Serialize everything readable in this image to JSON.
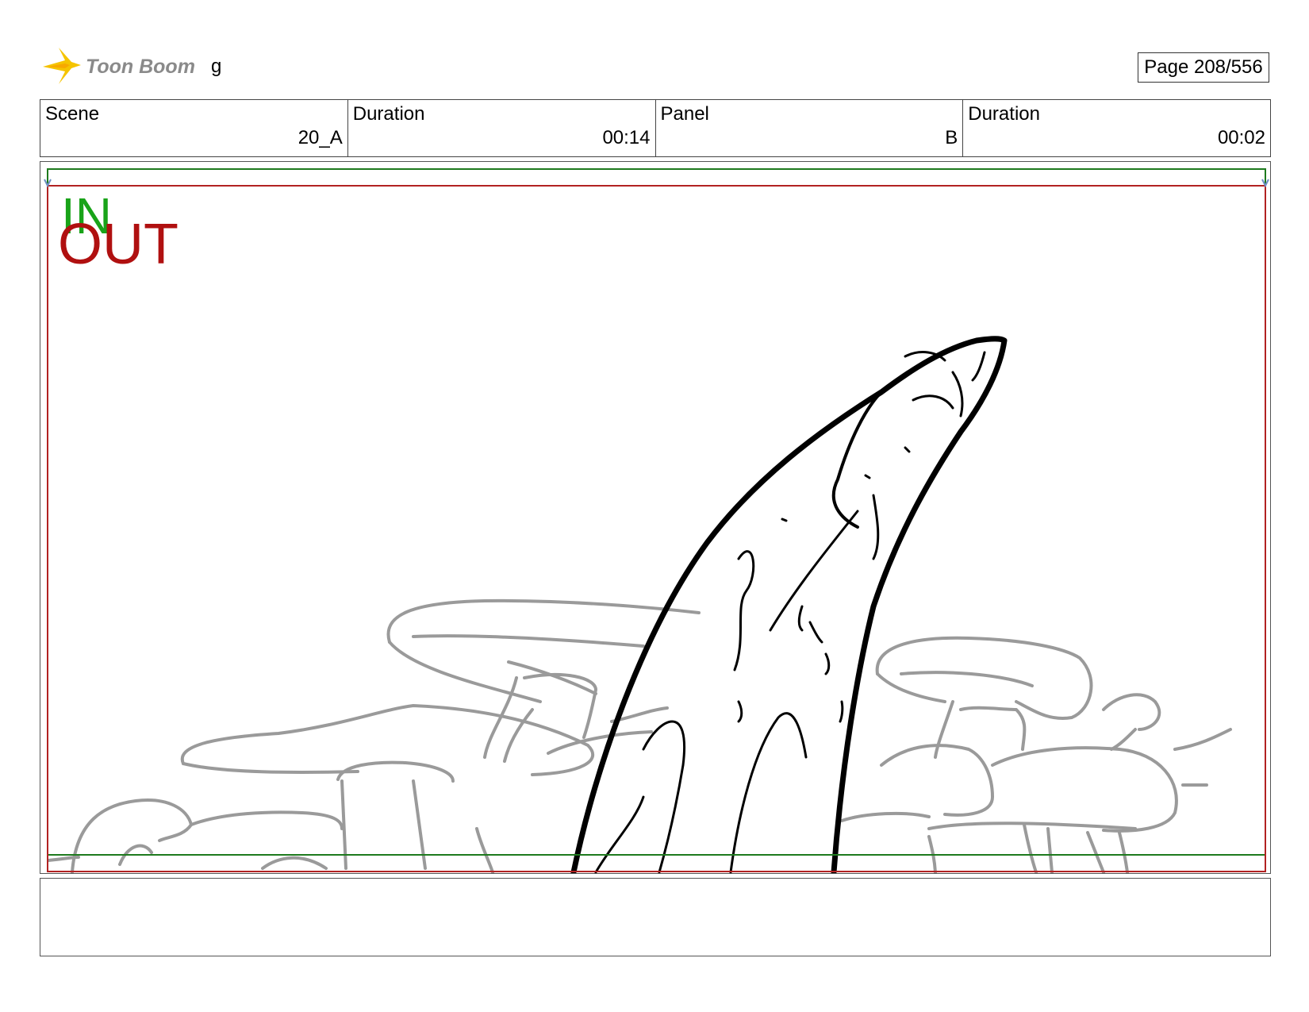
{
  "header": {
    "logo_text": "Toon Boom",
    "project_name": "g",
    "page": "Page 208/556"
  },
  "info": {
    "scene_label": "Scene",
    "scene_value": "20_A",
    "scene_duration_label": "Duration",
    "scene_duration_value": "00:14",
    "panel_label": "Panel",
    "panel_value": "B",
    "panel_duration_label": "Duration",
    "panel_duration_value": "00:02"
  },
  "panel": {
    "in_label": "IN",
    "out_label": "OUT",
    "colors": {
      "in_frame": "#1e7a1e",
      "out_frame": "#b22222",
      "in_text": "#19a319",
      "out_text": "#b01010",
      "sketch_main": "#000000",
      "sketch_background": "#9a9a9a"
    }
  },
  "caption": {
    "text": ""
  }
}
